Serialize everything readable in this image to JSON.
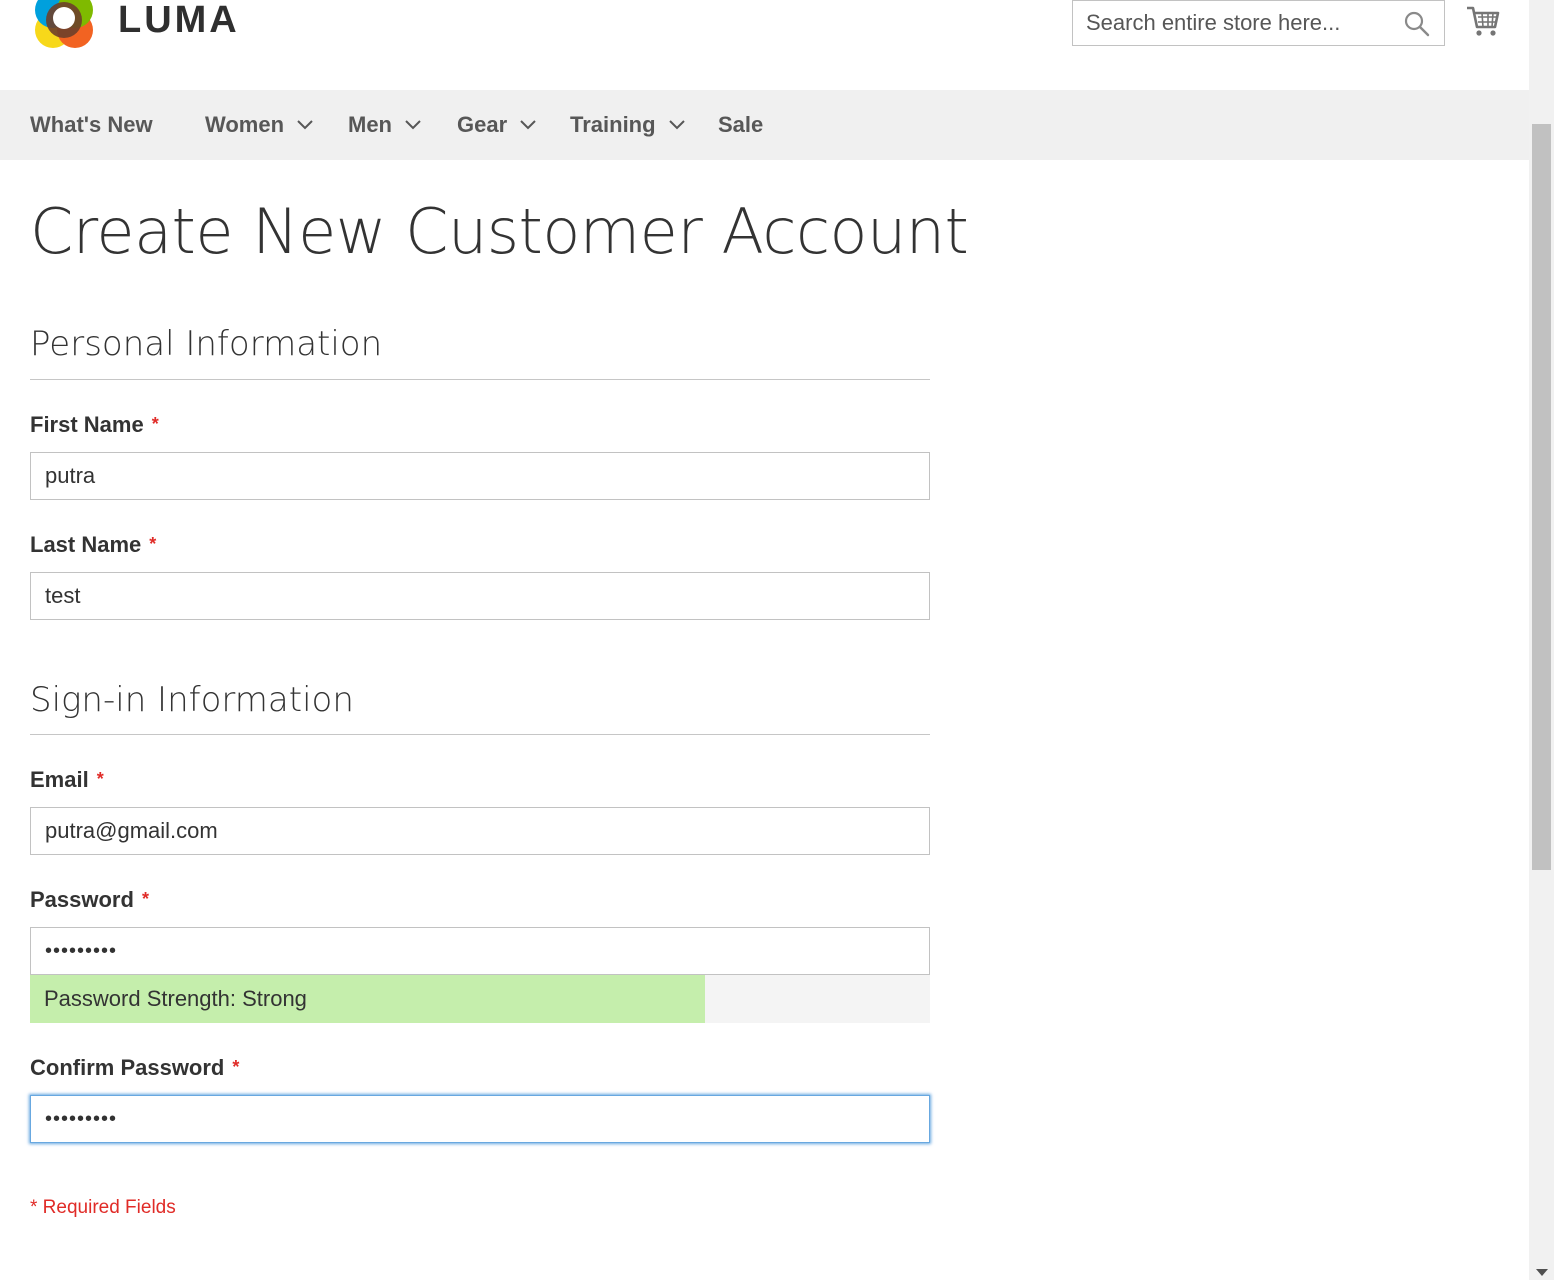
{
  "header": {
    "logo_text": "LUMA",
    "search_placeholder": "Search entire store here...",
    "search_icon": "search-icon",
    "cart_icon": "cart-icon"
  },
  "nav": {
    "items": [
      {
        "label": "What's New",
        "has_dropdown": false
      },
      {
        "label": "Women",
        "has_dropdown": true
      },
      {
        "label": "Men",
        "has_dropdown": true
      },
      {
        "label": "Gear",
        "has_dropdown": true
      },
      {
        "label": "Training",
        "has_dropdown": true
      },
      {
        "label": "Sale",
        "has_dropdown": false
      }
    ]
  },
  "page": {
    "title": "Create New Customer Account"
  },
  "personal": {
    "title": "Personal Information",
    "first_name_label": "First Name",
    "first_name_value": "putra",
    "last_name_label": "Last Name",
    "last_name_value": "test"
  },
  "signin": {
    "title": "Sign-in Information",
    "email_label": "Email",
    "email_value": "putra@gmail.com",
    "password_label": "Password",
    "password_value": "•••••••••",
    "strength_text": "Password Strength: Strong",
    "strength_level": 0.75,
    "confirm_label": "Confirm Password",
    "confirm_value": "•••••••••"
  },
  "required_mark": "*",
  "required_note": "* Required Fields",
  "colors": {
    "required": "#e02b27",
    "nav_bg": "#f0f0f0",
    "strength_fill": "#c5eeac",
    "focus": "#68a8e0"
  }
}
